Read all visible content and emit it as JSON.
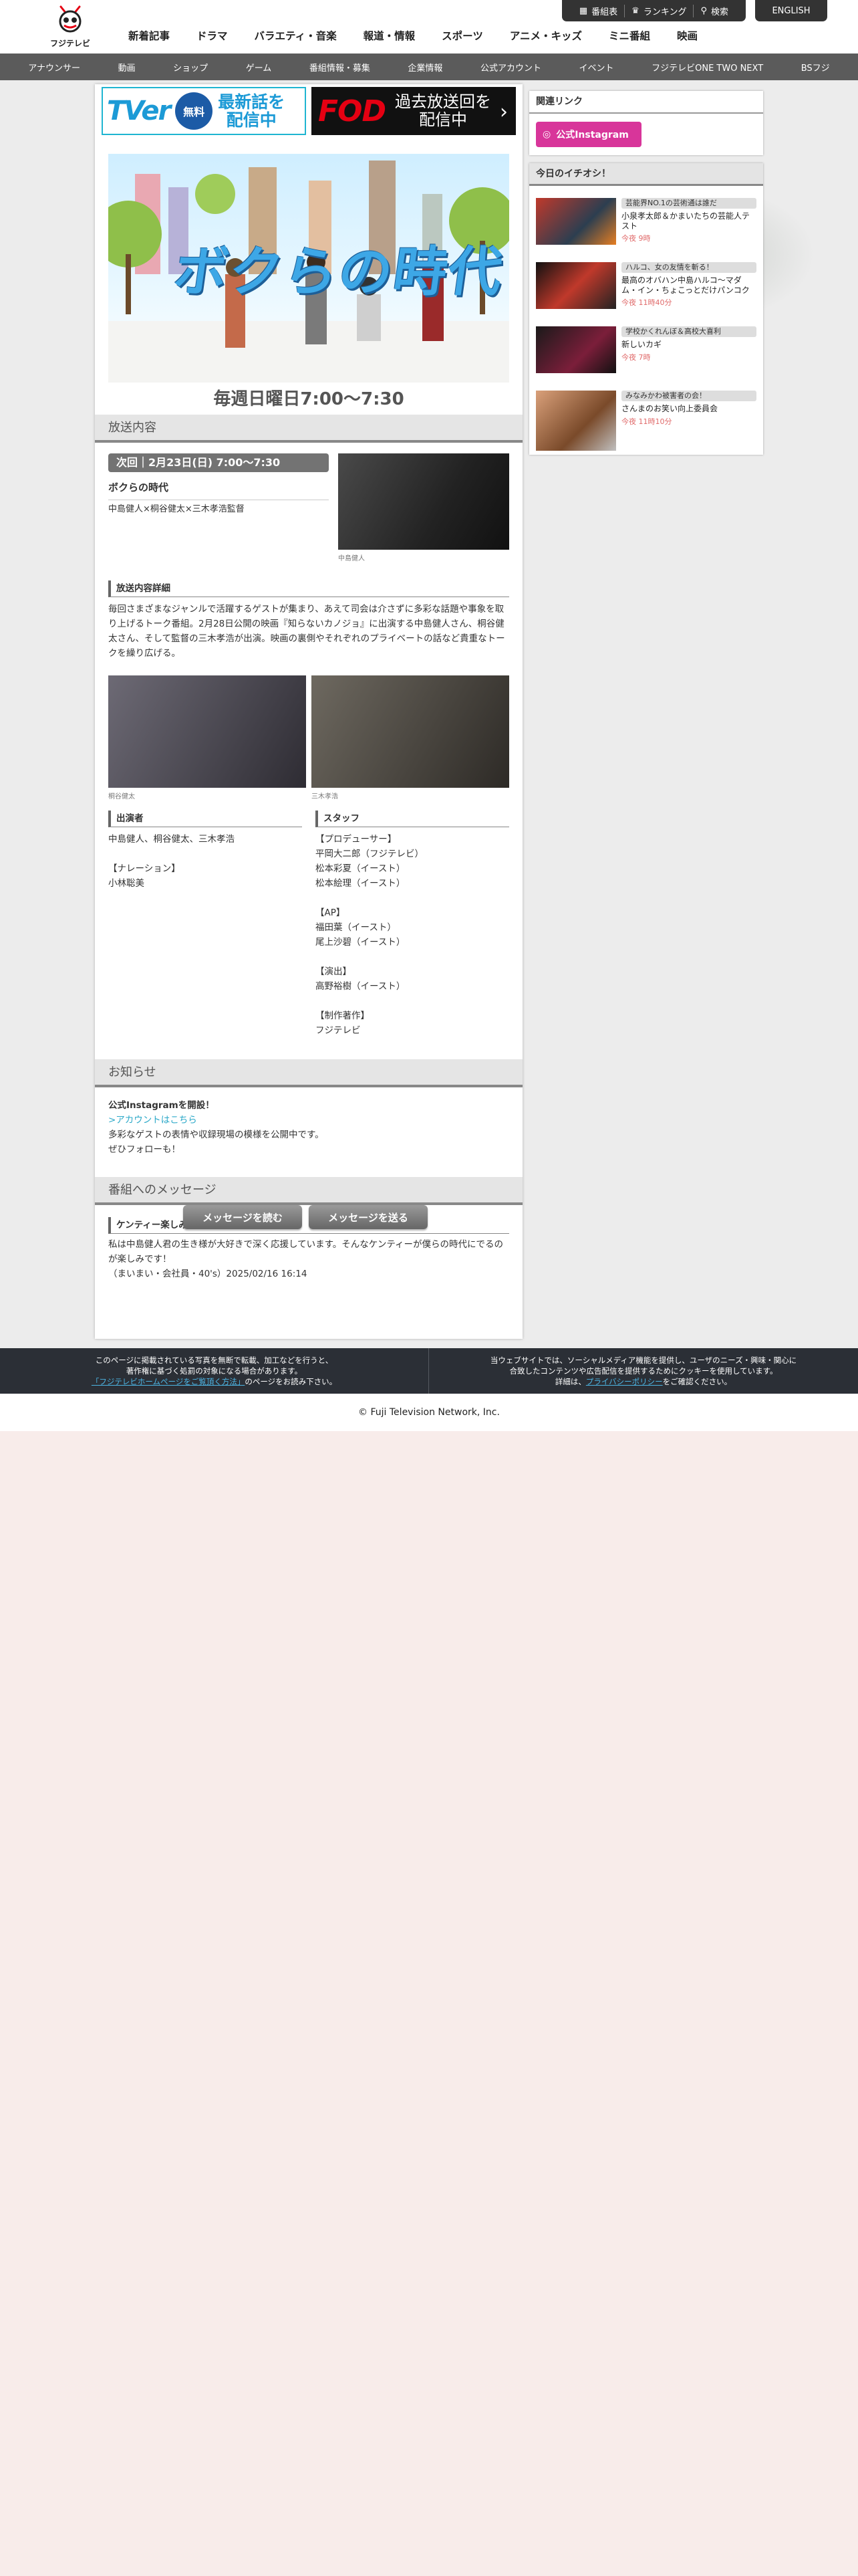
{
  "header": {
    "logo_text": "フジテレビ",
    "util": [
      "番組表",
      "ランキング",
      "検索"
    ],
    "lang": "ENGLISH",
    "main_nav": [
      "新着記事",
      "ドラマ",
      "バラエティ・音楽",
      "報道・情報",
      "スポーツ",
      "アニメ・キッズ",
      "ミニ番組",
      "映画"
    ],
    "sub_nav": [
      "アナウンサー",
      "動画",
      "ショップ",
      "ゲーム",
      "番組情報・募集",
      "企業情報",
      "公式アカウント",
      "イベント",
      "フジテレビONE TWO NEXT",
      "BSフジ"
    ]
  },
  "banners": {
    "tver_logo": "TVer",
    "tver_badge": "無料",
    "tver_text": "最新話を\n配信中",
    "fod_logo": "FOD",
    "fod_text": "過去放送回を\n配信中"
  },
  "hero": {
    "title": "ボクらの時代",
    "schedule": "毎週日曜日7:00〜7:30"
  },
  "broadcast": {
    "heading": "放送内容",
    "next_label": "次回｜2月23日(日) 7:00〜7:30",
    "program_title": "ボクらの時代",
    "cast_line": "中島健人×桐谷健太×三木孝浩監督",
    "photo1_caption": "中島健人",
    "detail_heading": "放送内容詳細",
    "detail_text": "毎回さまざまなジャンルで活躍するゲストが集まり、あえて司会は介さずに多彩な話題や事象を取り上げるトーク番組。2月28日公開の映画『知らないカノジョ』に出演する中島健人さん、桐谷健太さん、そして監督の三木孝浩が出演。映画の裏側やそれぞれのプライベートの話など貴重なトークを繰り広げる。",
    "photo2_caption": "桐谷健太",
    "photo3_caption": "三木孝浩",
    "cast_heading": "出演者",
    "cast_text": "中島健人、桐谷健太、三木孝浩\n\n【ナレーション】\n小林聡美",
    "staff_heading": "スタッフ",
    "staff_text": "【プロデューサー】\n平岡大二郎（フジテレビ）\n松本彩夏（イースト）\n松本絵理（イースト）\n\n【AP】\n福田葉（イースト）\n尾上沙碧（イースト）\n\n【演出】\n高野裕樹（イースト）\n\n【制作著作】\nフジテレビ"
  },
  "notice": {
    "heading": "お知らせ",
    "title": "公式Instagramを開設！",
    "link": ">アカウントはこちら",
    "text": "多彩なゲストの表情や収録現場の模様を公開中です。\nぜひフォローも！"
  },
  "messages": {
    "heading": "番組へのメッセージ",
    "msg_title": "ケンティー楽しみです！",
    "msg_text": "私は中島健人君の生き様が大好きで深く応援しています。そんなケンティーが僕らの時代にでるのが楽しみです！\n（まいまい・会社員・40's）2025/02/16 16:14",
    "read_btn": "メッセージを読む",
    "send_btn": "メッセージを送る"
  },
  "side": {
    "related_heading": "関連リンク",
    "insta_label": "公式Instagram",
    "pick_heading": "今日のイチオシ！",
    "picks": [
      {
        "cat": "芸能界NO.1の芸術通は誰だ",
        "title": "小泉孝太郎＆かまいたちの芸能人テスト",
        "time": "今夜 9時"
      },
      {
        "cat": "ハルコ、女の友情を斬る！",
        "title": "最高のオバハン中島ハルコ～マダム・イン・ちょこっとだけパンコク～",
        "time": "今夜 11時40分"
      },
      {
        "cat": "学校かくれんぼ＆高校大喜利",
        "title": "新しいカギ",
        "time": "今夜 7時"
      },
      {
        "cat": "みなみかわ被害者の会！",
        "title": "さんまのお笑い向上委員会",
        "time": "今夜 11時10分"
      }
    ]
  },
  "footer": {
    "left_line1": "このページに掲載されている写真を無断で転載、加工などを行うと、",
    "left_line2": "著作権に基づく処罰の対象になる場合があります。",
    "left_link": "「フジテレビホームページをご覧頂く方法」",
    "left_line3": "のページをお読み下さい。",
    "right_line1": "当ウェブサイトでは、ソーシャルメディア機能を提供し、ユーザのニーズ・興味・関心に",
    "right_line2": "合致したコンテンツや広告配信を提供するためにクッキーを使用しています。",
    "right_prefix": "詳細は、",
    "right_link": "プライバシーポリシー",
    "right_suffix": "をご確認ください。",
    "copyright": "© Fuji Television Network, Inc."
  }
}
